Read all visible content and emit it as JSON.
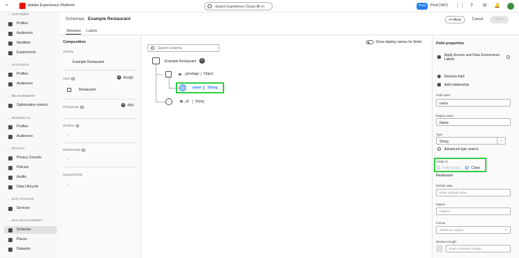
{
  "app": {
    "title": "Adobe Experience Platform",
    "search_placeholder": "Search Experience Cloud (⌘+/)",
    "env_badge": "Prod",
    "env_name": "Prod (VA7)"
  },
  "nav": {
    "sections": [
      {
        "title": "CUSTOMER",
        "items": [
          "Profiles",
          "Audiences",
          "Identities",
          "Experiments"
        ]
      },
      {
        "title": "ACCOUNTS",
        "items": [
          "Profiles",
          "Audiences"
        ]
      },
      {
        "title": "MEASUREMENT",
        "items": [
          "Optimization metrics"
        ]
      },
      {
        "title": "PROSPECTS",
        "items": [
          "Profiles",
          "Audiences"
        ]
      },
      {
        "title": "PRIVACY",
        "items": [
          "Privacy Console",
          "Policies",
          "Audits",
          "Data Lifecycle"
        ]
      },
      {
        "title": "DATA SCIENCE",
        "items": [
          "Services"
        ]
      },
      {
        "title": "DATA MANAGEMENT",
        "items": [
          "Schemas",
          "Places",
          "Datasets"
        ]
      }
    ]
  },
  "header": {
    "breadcrumb_parent": "Schemas",
    "breadcrumb_current": "Example Restaurant",
    "more_label": "More",
    "cancel_label": "Cancel",
    "save_label": "Save",
    "tabs": [
      "Structure",
      "Labels"
    ]
  },
  "composition": {
    "title": "Composition",
    "schema_label": "Schema",
    "schema_value": "Example Restaurant",
    "class_label": "Class",
    "assign_label": "Assign",
    "class_value": "Restaurant",
    "field_groups_label": "Field groups",
    "add_label": "Add",
    "identities_label": "Identities",
    "identities_value": "-",
    "relationships_label": "Relationships",
    "relationships_value": "-",
    "required_label": "Required fields",
    "required_value": "-"
  },
  "canvas": {
    "search_placeholder": "Search schema",
    "toggle_label": "Show display names for fields",
    "root": "Example Restaurant",
    "nodes": [
      {
        "name": "_cjmstage",
        "type": "Object"
      },
      {
        "name": "name",
        "type": "String"
      },
      {
        "name": "_id",
        "type": "String"
      }
    ]
  },
  "field_properties": {
    "title": "Field properties",
    "apply_labels": "Apply Access and Data Governance Labels",
    "remove_field": "Remove field",
    "add_relationship": "Add relationship",
    "field_name_label": "Field name",
    "field_name_value": "name",
    "display_name_label": "Display name",
    "display_name_value": "Name",
    "type_label": "Type",
    "type_value": "String",
    "advanced_type_search": "Advanced type search",
    "assign_to_label": "Assign to",
    "assign_options": [
      "Field Group",
      "Class"
    ],
    "assign_selected": "Class",
    "assign_value": "Restaurant",
    "default_value_label": "Default value",
    "default_value_placeholder": "Enter default value",
    "pattern_label": "Pattern",
    "pattern_placeholder": "Pattern",
    "format_label": "Format",
    "format_placeholder": "Select an option",
    "min_length_label": "Minimum length",
    "min_length_placeholder": "Enter minimum length"
  }
}
